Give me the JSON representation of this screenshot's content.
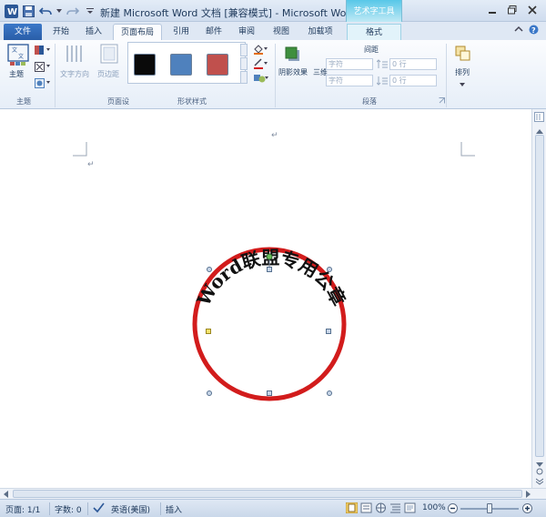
{
  "titlebar": {
    "title": "新建 Microsoft Word 文档 [兼容模式] - Microsoft Word",
    "context_group": "艺术字工具"
  },
  "tabs": {
    "file": "文件",
    "items": [
      "开始",
      "插入",
      "页面布局",
      "引用",
      "邮件",
      "审阅",
      "视图",
      "加载项"
    ],
    "active": "页面布局",
    "context": "格式"
  },
  "ribbon": {
    "theme_label": "主题",
    "theme_group": "主题",
    "text_direction": "文字方向",
    "margins": "页边距",
    "page_group": "页面设",
    "shape_styles_group": "形状样式",
    "shadow_effect": "阴影效果",
    "threed": "三维",
    "spacing_label": "间距",
    "indent_left": "字符",
    "indent_right": "字符",
    "spacing_before": "0 行",
    "spacing_after": "0 行",
    "paragraph_group": "段落",
    "arrange": "排列",
    "swatch_colors": [
      "#0a0a0a",
      "#4f81bd",
      "#c0504d"
    ]
  },
  "document": {
    "seal_text": "Word联盟专用公章",
    "ring_color": "#d21c1c"
  },
  "statusbar": {
    "page": "页面: 1/1",
    "words": "字数: 0",
    "language": "英语(美国)",
    "mode": "插入",
    "zoom": "100%"
  }
}
